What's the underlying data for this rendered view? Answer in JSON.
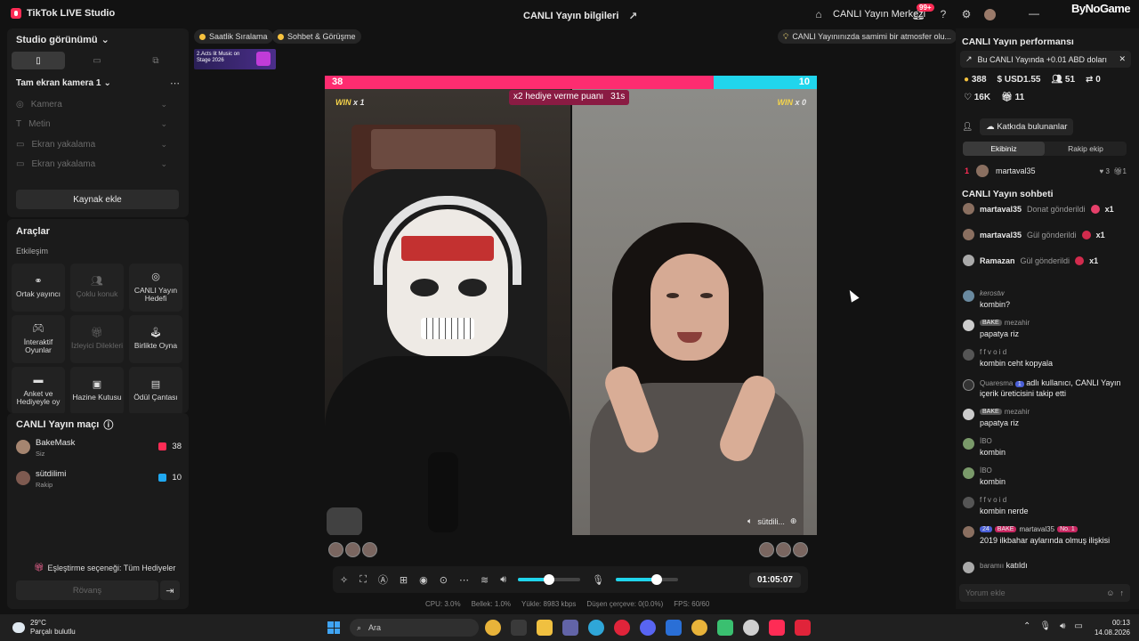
{
  "window": {
    "app_title": "TikTok LIVE Studio",
    "center_title": "CANLI Yayın bilgileri",
    "live_center": "CANLI Yayın Merkezi",
    "notification_badge": "99+",
    "watermark": "ByNoGame"
  },
  "studio": {
    "view_label": "Studio görünümü",
    "scene_label": "Tam ekran kamera 1",
    "sources": [
      "Kamera",
      "Metin",
      "Ekran yakalama",
      "Ekran yakalama"
    ],
    "add_source": "Kaynak ekle"
  },
  "tools": {
    "title": "Araçlar",
    "section": "Etkileşim",
    "items": [
      {
        "label": "Ortak yayıncı",
        "enabled": true
      },
      {
        "label": "Çoklu konuk",
        "enabled": false
      },
      {
        "label": "CANLI Yayın Hedefi",
        "enabled": true
      },
      {
        "label": "İnteraktif Oyunlar",
        "enabled": true
      },
      {
        "label": "İzleyici Dilekleri",
        "enabled": false
      },
      {
        "label": "Birlikte Oyna",
        "enabled": true
      },
      {
        "label": "Anket ve Hediyeyle oy",
        "enabled": true
      },
      {
        "label": "Hazine Kutusu",
        "enabled": true
      },
      {
        "label": "Ödül Çantası",
        "enabled": true
      }
    ]
  },
  "match": {
    "title": "CANLI Yayın maçı",
    "players": [
      {
        "name": "BakeMask",
        "role": "Siz",
        "score": "38",
        "color": "#fe2c55"
      },
      {
        "name": "sütdilimi",
        "role": "Rakip",
        "score": "10",
        "color": "#20a8f0"
      }
    ],
    "pairing": "Eşleştirme seçeneği: Tüm Hediyeler",
    "rematch": "Rövanş"
  },
  "top_pills": {
    "ranking": "Saatlik Sıralama",
    "chat": "Sohbet & Görüşme",
    "tip": "CANLI Yayınınızda samimi bir atmosfer olu..."
  },
  "banner": {
    "text": "2.Acts lit Music on Stage 2026"
  },
  "battle": {
    "left_score": "38",
    "right_score": "10",
    "left_share": 0.79,
    "gift_label": "x2 hediye verme puanı",
    "gift_timer": "31s",
    "win_left_label": "WIN",
    "win_left_count": "x 1",
    "win_right_label": "WIN",
    "win_right_count": "x 0",
    "guest_tag": "sütdili..."
  },
  "controls": {
    "timer": "01:05:07",
    "speaker_level": 0.5,
    "mic_level": 0.65
  },
  "stats": {
    "cpu": "CPU:  3.0%",
    "memory": "Bellek:  1.0%",
    "upload": "Yükle:  8983 kbps",
    "dropped": "Düşen çerçeve:  0(0.0%)",
    "fps": "FPS:  60/60"
  },
  "performance": {
    "title": "CANLI Yayın performansı",
    "earn_text": "Bu CANLI Yayında +0.01 ABD doları",
    "coins": "388",
    "usd": "USD1.55",
    "viewers": "51",
    "zero": "0",
    "likes": "16K",
    "gifts": "11",
    "contributors": "Katkıda bulunanlar",
    "team_own": "Ekibiniz",
    "team_rival": "Rakip ekip",
    "rank": {
      "num": "1",
      "name": "martaval35",
      "hearts": "3",
      "gifts": "1"
    }
  },
  "chat": {
    "title": "CANLI Yayın sohbeti",
    "gift_messages": [
      {
        "user": "martaval35",
        "action": "Donat gönderildi",
        "count": "x1"
      },
      {
        "user": "martaval35",
        "action": "Gül gönderildi",
        "count": "x1"
      },
      {
        "user": "Ramazan",
        "action": "Gül gönderildi",
        "count": "x1"
      }
    ],
    "messages": [
      {
        "user": "kerostw",
        "tag": "",
        "text": "kombin?"
      },
      {
        "user": "mezahir",
        "tag": "BAKE",
        "text": "papatya riz"
      },
      {
        "user": "f f v o i d",
        "tag": "",
        "text": "kombin ceht kopyala"
      },
      {
        "user": "Quaresma",
        "tag": "1",
        "text": "adlı kullanıcı, CANLI Yayın içerik üreticisini takip etti"
      },
      {
        "user": "mezahir",
        "tag": "BAKE",
        "text": "papatya riz"
      },
      {
        "user": "İBO",
        "tag": "",
        "text": "kombin"
      },
      {
        "user": "İBO",
        "tag": "",
        "text": "kombin"
      },
      {
        "user": "f f v o i d",
        "tag": "",
        "text": "kombin nerde"
      },
      {
        "user": "martaval35",
        "tag": "24",
        "tag2": "BAKE",
        "tag3": "No. 1",
        "text": "2019 ilkbahar aylarında olmuş ilişkisi"
      }
    ],
    "joined_user": "baramıı",
    "joined_text": "katıldı",
    "comment_placeholder": "Yorum ekle"
  },
  "taskbar": {
    "temp": "29°C",
    "weather": "Parçalı bulutlu",
    "search": "Ara",
    "time": "00:13",
    "date": "14.08.2026"
  }
}
